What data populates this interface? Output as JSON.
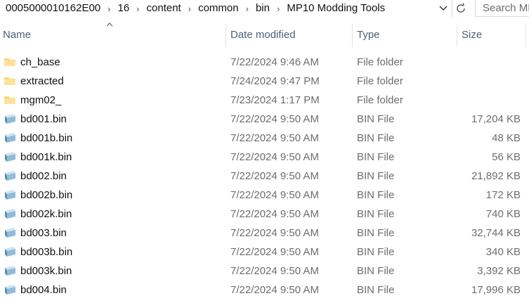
{
  "address": {
    "crumbs": [
      "0005000010162E00",
      "16",
      "content",
      "common",
      "bin",
      "MP10 Modding Tools"
    ],
    "search_placeholder": "Search MP"
  },
  "columns": {
    "name": "Name",
    "date": "Date modified",
    "type": "Type",
    "size": "Size"
  },
  "files": [
    {
      "name": "ch_base",
      "date": "7/22/2024 9:46 AM",
      "type": "File folder",
      "size": "",
      "icon": "folder-icon"
    },
    {
      "name": "extracted",
      "date": "7/24/2024 9:47 PM",
      "type": "File folder",
      "size": "",
      "icon": "folder-icon"
    },
    {
      "name": "mgm02_",
      "date": "7/23/2024 1:17 PM",
      "type": "File folder",
      "size": "",
      "icon": "folder-icon"
    },
    {
      "name": "bd001.bin",
      "date": "7/22/2024 9:50 AM",
      "type": "BIN File",
      "size": "17,204 KB",
      "icon": "file-icon"
    },
    {
      "name": "bd001b.bin",
      "date": "7/22/2024 9:50 AM",
      "type": "BIN File",
      "size": "48 KB",
      "icon": "file-icon"
    },
    {
      "name": "bd001k.bin",
      "date": "7/22/2024 9:50 AM",
      "type": "BIN File",
      "size": "56 KB",
      "icon": "file-icon"
    },
    {
      "name": "bd002.bin",
      "date": "7/22/2024 9:50 AM",
      "type": "BIN File",
      "size": "21,892 KB",
      "icon": "file-icon"
    },
    {
      "name": "bd002b.bin",
      "date": "7/22/2024 9:50 AM",
      "type": "BIN File",
      "size": "172 KB",
      "icon": "file-icon"
    },
    {
      "name": "bd002k.bin",
      "date": "7/22/2024 9:50 AM",
      "type": "BIN File",
      "size": "740 KB",
      "icon": "file-icon"
    },
    {
      "name": "bd003.bin",
      "date": "7/22/2024 9:50 AM",
      "type": "BIN File",
      "size": "32,744 KB",
      "icon": "file-icon"
    },
    {
      "name": "bd003b.bin",
      "date": "7/22/2024 9:50 AM",
      "type": "BIN File",
      "size": "340 KB",
      "icon": "file-icon"
    },
    {
      "name": "bd003k.bin",
      "date": "7/22/2024 9:50 AM",
      "type": "BIN File",
      "size": "3,392 KB",
      "icon": "file-icon"
    },
    {
      "name": "bd004.bin",
      "date": "7/22/2024 9:50 AM",
      "type": "BIN File",
      "size": "17,996 KB",
      "icon": "file-icon"
    }
  ]
}
